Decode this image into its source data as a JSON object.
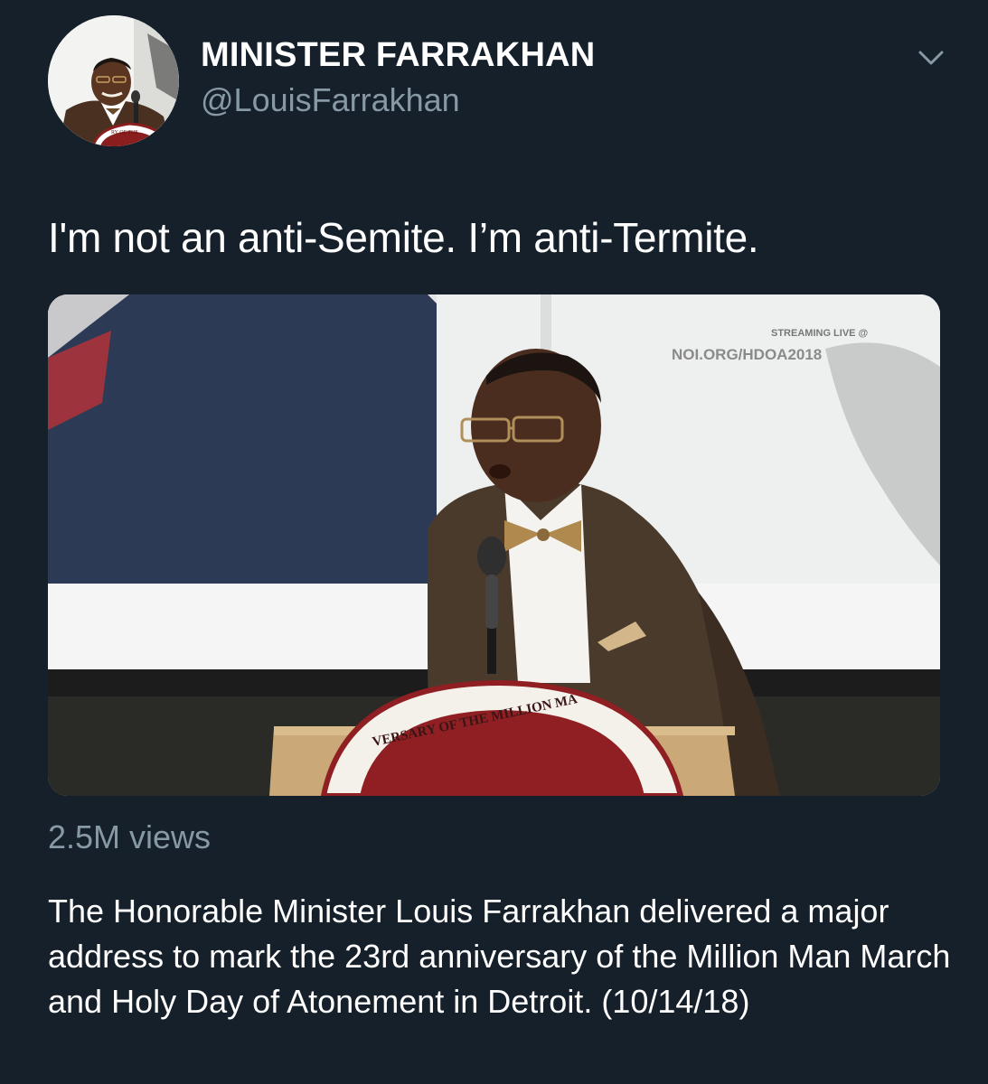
{
  "author": {
    "display_name": "MINISTER FARRAKHAN",
    "handle": "@LouisFarrakhan",
    "avatar_icon": "profile-photo-speaker-at-podium"
  },
  "menu": {
    "icon": "chevron-down-icon"
  },
  "tweet": {
    "text": "I'm not an anti-Semite. I’m anti-Termite."
  },
  "video": {
    "overlay_line_1": "STREAMING LIVE @",
    "overlay_line_2": "NOI.ORG/HDOA2018",
    "podium_text": "VERSARY OF THE MILLION MA",
    "avatar_podium_text": "RY OF THE"
  },
  "stats": {
    "views": "2.5M views"
  },
  "description": "The Honorable Minister Louis Farrakhan delivered a major address to mark the 23rd anniversary of the Million Man March and Holy Day of Atonement in Detroit. (10/14/18)",
  "colors": {
    "background": "#15202b",
    "primary_text": "#ffffff",
    "secondary_text": "#8899a6"
  }
}
